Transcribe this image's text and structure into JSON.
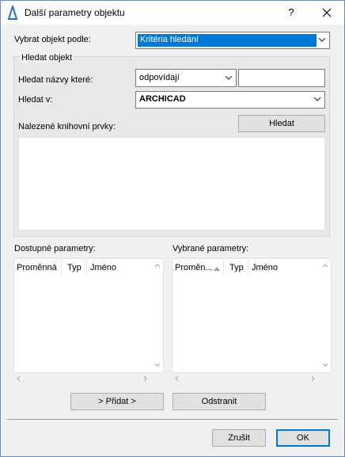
{
  "window": {
    "title": "Další parametry objektu",
    "help_label": "?"
  },
  "select_by": {
    "label": "Vybrat objekt podle:",
    "value": "Kritéria hledání"
  },
  "search_group": {
    "title": "Hledat objekt",
    "find_names_label": "Hledat názvy které:",
    "match_value": "odpovídají",
    "name_value": "",
    "search_in_label": "Hledat v:",
    "search_in_value": "ARCHICAD",
    "found_label": "Nalezené knihovní prvky:",
    "search_button": "Hledat"
  },
  "available": {
    "label": "Dostupné parametry:",
    "columns": [
      "Proměnná",
      "Typ",
      "Jméno"
    ]
  },
  "selected": {
    "label": "Vybrané parametry:",
    "columns": [
      "Proměn...",
      "Typ",
      "Jméno"
    ]
  },
  "actions": {
    "add": "> Přidat >",
    "remove": "Odstranit"
  },
  "footer": {
    "cancel": "Zrušit",
    "ok": "OK"
  },
  "colors": {
    "selection": "#0078d7",
    "window_border": "#6b8db5",
    "dialog_bg": "#f0f0f0"
  }
}
